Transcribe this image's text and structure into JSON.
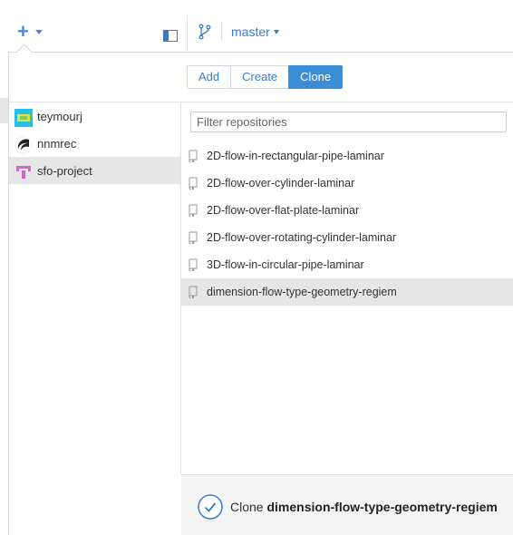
{
  "toolbar": {
    "add_icon": "plus-icon",
    "panel_icon": "panel-toggle-icon",
    "branch_icon": "branch-icon",
    "branch": "master"
  },
  "clone_popover": {
    "tabs": [
      {
        "label": "Add",
        "active": false
      },
      {
        "label": "Create",
        "active": false
      },
      {
        "label": "Clone",
        "active": true
      }
    ],
    "accounts": [
      {
        "name": "teymourj",
        "selected": false
      },
      {
        "name": "nnmrec",
        "selected": false
      },
      {
        "name": "sfo-project",
        "selected": true
      }
    ],
    "filter_placeholder": "Filter repositories",
    "repositories": [
      {
        "name": "2D-flow-in-rectangular-pipe-laminar",
        "selected": false
      },
      {
        "name": "2D-flow-over-cylinder-laminar",
        "selected": false
      },
      {
        "name": "2D-flow-over-flat-plate-laminar",
        "selected": false
      },
      {
        "name": "2D-flow-over-rotating-cylinder-laminar",
        "selected": false
      },
      {
        "name": "3D-flow-in-circular-pipe-laminar",
        "selected": false
      },
      {
        "name": "dimension-flow-type-geometry-regiem",
        "selected": true
      }
    ],
    "footer": {
      "action_label": "Clone",
      "repo_name": "dimension-flow-type-geometry-regiem"
    }
  },
  "colors": {
    "accent": "#3c8dd8",
    "selection": "#e6e6e6",
    "footer_bg": "#f4f4f4"
  }
}
